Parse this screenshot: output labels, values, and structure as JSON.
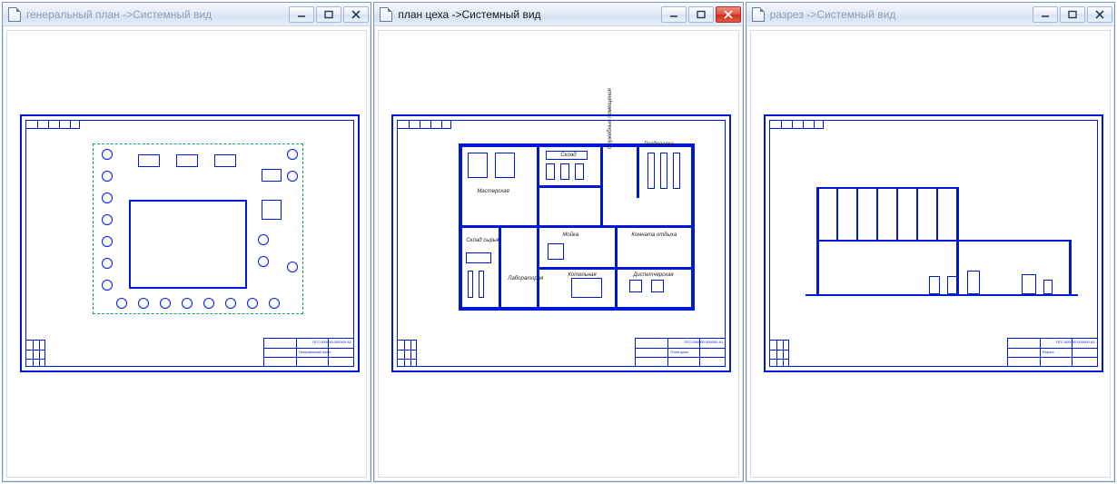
{
  "windows": [
    {
      "title_doc": "генеральный план",
      "title_sep": " ->",
      "title_view": "Системный вид",
      "active": false,
      "close_hot": false,
      "drawing": {
        "titleblock_label": "Генеральный план",
        "sheet_code": "ПГС.000000.000000 А1"
      }
    },
    {
      "title_doc": "план цеха",
      "title_sep": " ->",
      "title_view": "Системный вид",
      "active": true,
      "close_hot": true,
      "drawing": {
        "titleblock_label": "План цеха",
        "sheet_code": "ПГС.000000.000000 А1",
        "rooms": {
          "r1": "Мастерская",
          "r2": "Склад",
          "r3": "Служебные помещения",
          "r4": "Раздевалка",
          "r5": "Мойка",
          "r6": "Комната отдыха",
          "r7": "Лаборатория",
          "r8": "Котельная",
          "r9": "Диспетчерская",
          "r10": "Склад сырья"
        }
      }
    },
    {
      "title_doc": "разрез",
      "title_sep": " ->",
      "title_view": "Системный вид",
      "active": false,
      "close_hot": false,
      "drawing": {
        "titleblock_label": "Разрез",
        "sheet_code": "ПГС.000000.000000 А1"
      }
    }
  ]
}
